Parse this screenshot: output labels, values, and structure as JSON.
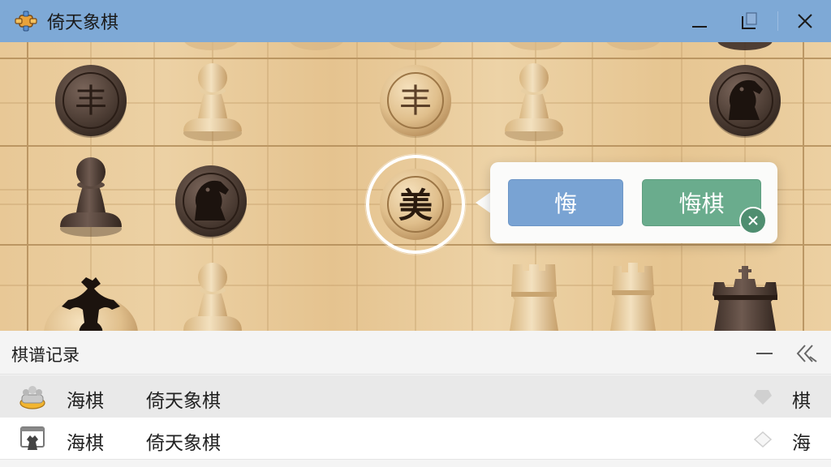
{
  "window": {
    "title": "倚天象棋",
    "icon": "chess-app-icon",
    "controls": [
      "minimize-icon",
      "maximize-icon",
      "close-icon"
    ]
  },
  "board": {
    "highlighted_piece": {
      "label": "美",
      "side": "light",
      "selected": true
    },
    "pieces_row1": [
      {
        "type": "char",
        "label": "丰",
        "side": "dark"
      },
      {
        "type": "pawn",
        "side": "light"
      },
      {
        "type": "char",
        "label": "丰",
        "side": "light"
      },
      {
        "type": "pawn",
        "side": "light"
      },
      {
        "type": "knight",
        "side": "dark"
      }
    ],
    "pieces_row2": [
      {
        "type": "pawn",
        "side": "dark"
      },
      {
        "type": "knight",
        "side": "dark"
      }
    ],
    "pieces_row3": [
      {
        "type": "king",
        "side": "light"
      },
      {
        "type": "pawn",
        "side": "light"
      },
      {
        "type": "rook",
        "side": "light"
      },
      {
        "type": "rook",
        "side": "light"
      },
      {
        "type": "queen",
        "side": "dark"
      }
    ]
  },
  "popup": {
    "undo_label": "悔",
    "regret_label": "悔棋",
    "close_icon": "close-icon"
  },
  "record_panel": {
    "title": "棋谱记录",
    "minimize_icon": "minus-icon",
    "collapse_icon": "double-chevron-left-icon",
    "rows": [
      {
        "icon": "crown-avatar-icon",
        "name": "海棋",
        "game": "倚天象棋",
        "marker": "filled-diamond-icon",
        "side": "棋"
      },
      {
        "icon": "board-avatar-icon",
        "name": "海棋",
        "game": "倚天象棋",
        "marker": "outline-diamond-icon",
        "side": "海"
      }
    ]
  },
  "colors": {
    "titlebar": "#7ea9d6",
    "undo_button": "#79a3d3",
    "regret_button": "#6aac8d",
    "board_wood": "#e8c896",
    "dark_piece": "#4a3a32",
    "light_piece": "#e2c395"
  }
}
